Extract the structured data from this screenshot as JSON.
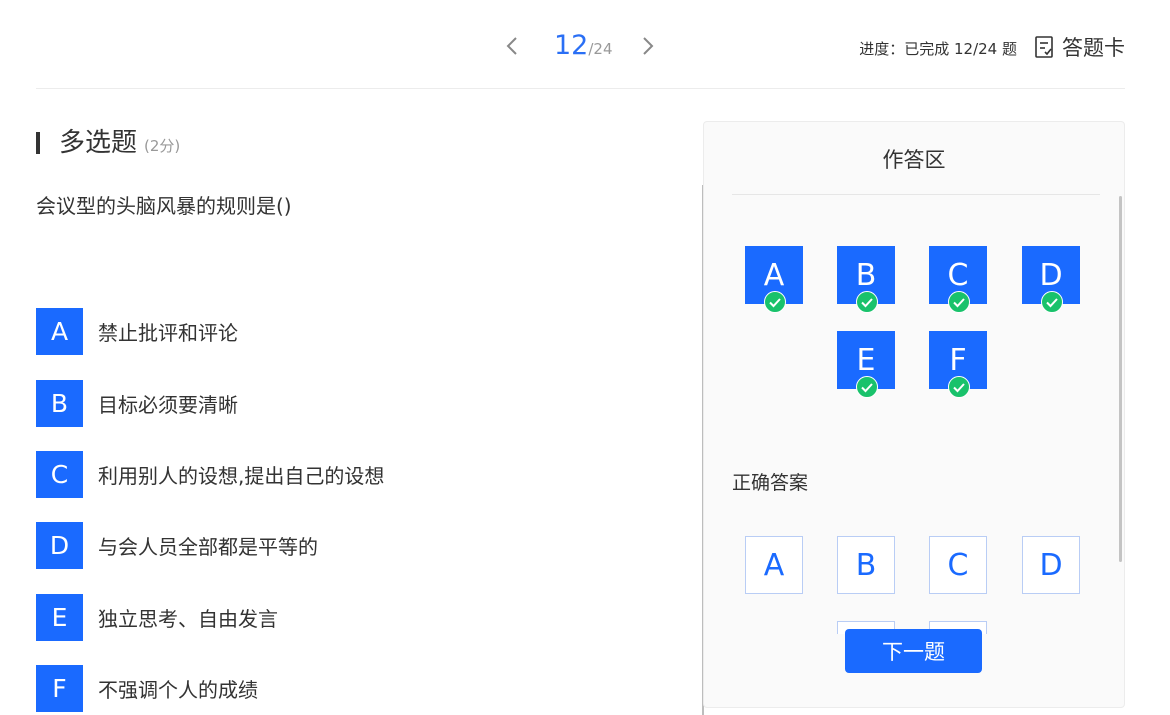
{
  "header": {
    "current": "12",
    "total": "/24",
    "progress_text": "进度：已完成 12/24 题",
    "card_label": "答题卡"
  },
  "question": {
    "type": "多选题",
    "score": "(2分)",
    "text": "会议型的头脑风暴的规则是()",
    "options": [
      {
        "letter": "A",
        "text": "禁止批评和评论"
      },
      {
        "letter": "B",
        "text": "目标必须要清晰"
      },
      {
        "letter": "C",
        "text": "利用别人的设想,提出自己的设想"
      },
      {
        "letter": "D",
        "text": "与会人员全部都是平等的"
      },
      {
        "letter": "E",
        "text": "独立思考、自由发言"
      },
      {
        "letter": "F",
        "text": "不强调个人的成绩"
      }
    ]
  },
  "answer_panel": {
    "title": "作答区",
    "selected": [
      "A",
      "B",
      "C",
      "D",
      "E",
      "F"
    ],
    "correct_label": "正确答案",
    "correct": [
      "A",
      "B",
      "C",
      "D"
    ],
    "next_label": "下一题"
  },
  "colors": {
    "accent": "#1a6aff",
    "check": "#19c26b"
  }
}
